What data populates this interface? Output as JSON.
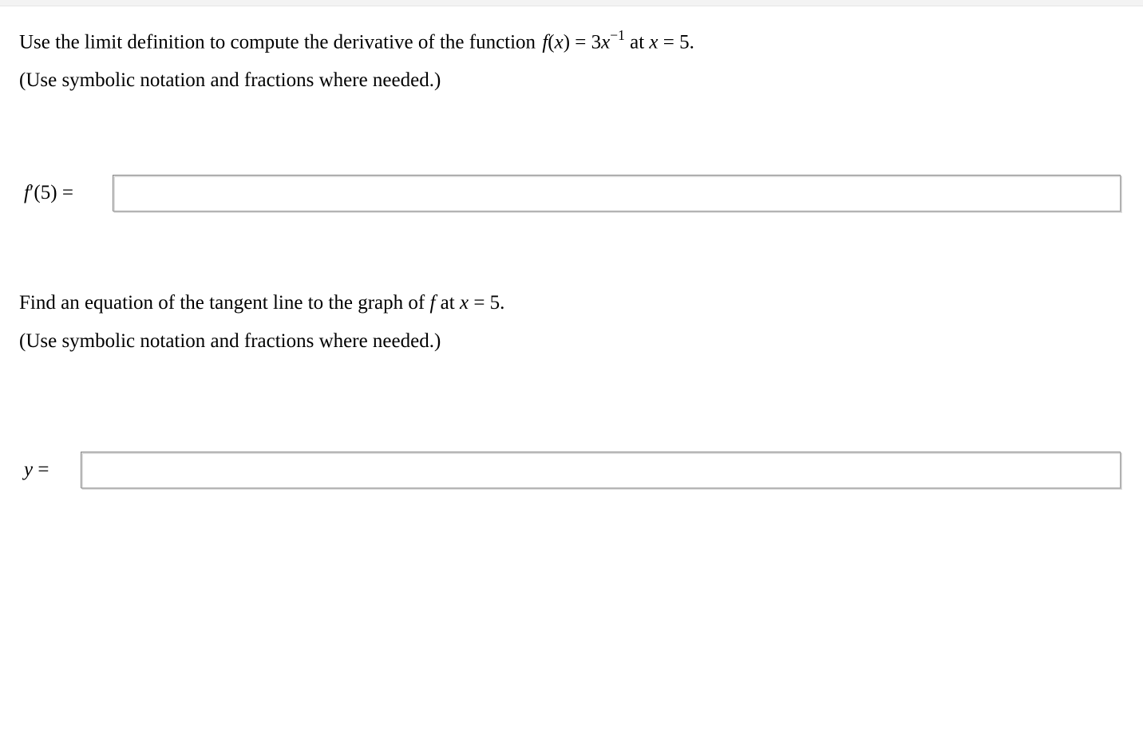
{
  "question1": {
    "text_before_fx": "Use the limit definition to compute the derivative of the function ",
    "fx_left": "f",
    "fx_paren_open": "(",
    "fx_var": "x",
    "fx_paren_close": ")",
    "equals1": " = 3",
    "x_var": "x",
    "exp": "−1",
    "text_after_exp": " at ",
    "x_at": "x",
    "equals2": " = 5.",
    "hint": "(Use symbolic notation and fractions where needed.)"
  },
  "answer1": {
    "label_f": "f",
    "label_prime": "′",
    "label_paren": "(5) ="
  },
  "question2": {
    "text_before_f": "Find an equation of the tangent line to the graph of ",
    "f": "f",
    "text_after_f": " at ",
    "x": "x",
    "eq": " = 5.",
    "hint": "(Use symbolic notation and fractions where needed.)"
  },
  "answer2": {
    "label_y": "y",
    "label_eq": " ="
  },
  "inputs": {
    "value1": "",
    "value2": ""
  }
}
